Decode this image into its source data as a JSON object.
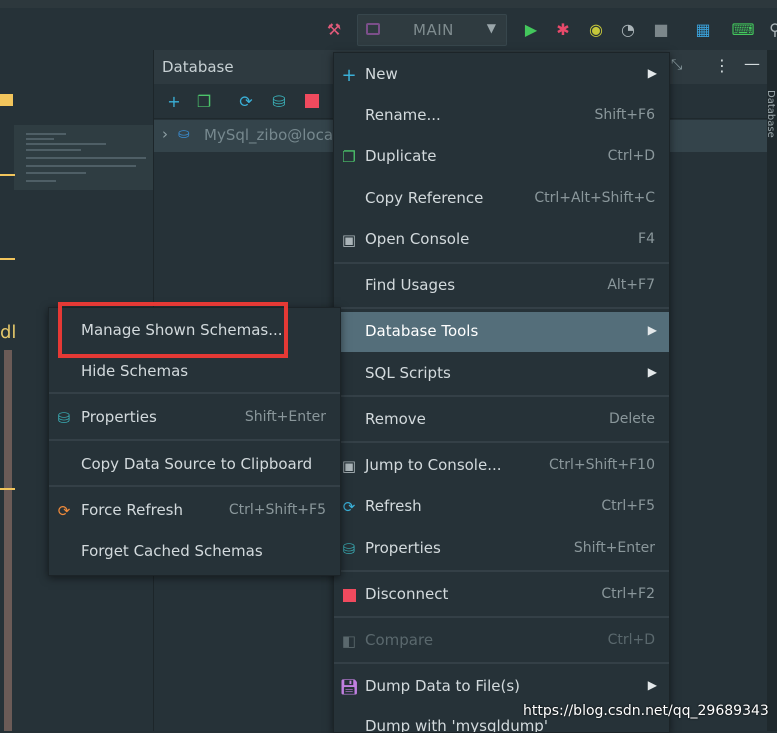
{
  "toolbar": {
    "run_config": "MAIN",
    "icons": [
      "hammer-icon",
      "run-icon",
      "debug-icon",
      "coverage-icon",
      "profiler-icon",
      "stop-icon",
      "layout-icon",
      "terminal-icon"
    ]
  },
  "db_panel": {
    "title": "Database",
    "tree_item": "MySql_zibo@loca",
    "side_tab": "Database"
  },
  "main_menu": {
    "items": [
      {
        "label": "New",
        "shortcut": "",
        "submenu": true
      },
      {
        "label": "Rename...",
        "shortcut": "Shift+F6"
      },
      {
        "label": "Duplicate",
        "shortcut": "Ctrl+D"
      },
      {
        "label": "Copy Reference",
        "shortcut": "Ctrl+Alt+Shift+C"
      },
      {
        "label": "Open Console",
        "shortcut": "F4"
      },
      {
        "label": "Find Usages",
        "shortcut": "Alt+F7"
      },
      {
        "label": "Database Tools",
        "shortcut": "",
        "submenu": true
      },
      {
        "label": "SQL Scripts",
        "shortcut": "",
        "submenu": true
      },
      {
        "label": "Remove",
        "shortcut": "Delete"
      },
      {
        "label": "Jump to Console...",
        "shortcut": "Ctrl+Shift+F10"
      },
      {
        "label": "Refresh",
        "shortcut": "Ctrl+F5"
      },
      {
        "label": "Properties",
        "shortcut": "Shift+Enter"
      },
      {
        "label": "Disconnect",
        "shortcut": "Ctrl+F2"
      },
      {
        "label": "Compare",
        "shortcut": "Ctrl+D"
      },
      {
        "label": "Dump Data to File(s)",
        "shortcut": "",
        "submenu": true
      },
      {
        "label": "Dump with 'mysqldump'",
        "shortcut": ""
      }
    ]
  },
  "sub_menu": {
    "items": [
      {
        "label": "Manage Shown Schemas...",
        "shortcut": ""
      },
      {
        "label": "Hide Schemas",
        "shortcut": ""
      },
      {
        "label": "Properties",
        "shortcut": "Shift+Enter"
      },
      {
        "label": "Copy Data Source to Clipboard",
        "shortcut": ""
      },
      {
        "label": "Force Refresh",
        "shortcut": "Ctrl+Shift+F5"
      },
      {
        "label": "Forget Cached Schemas",
        "shortcut": ""
      }
    ]
  },
  "watermark": "https://blog.csdn.net/qq_29689343",
  "colors": {
    "selected": "#546e7a",
    "highlight_box": "#e53935",
    "background": "#263238"
  }
}
